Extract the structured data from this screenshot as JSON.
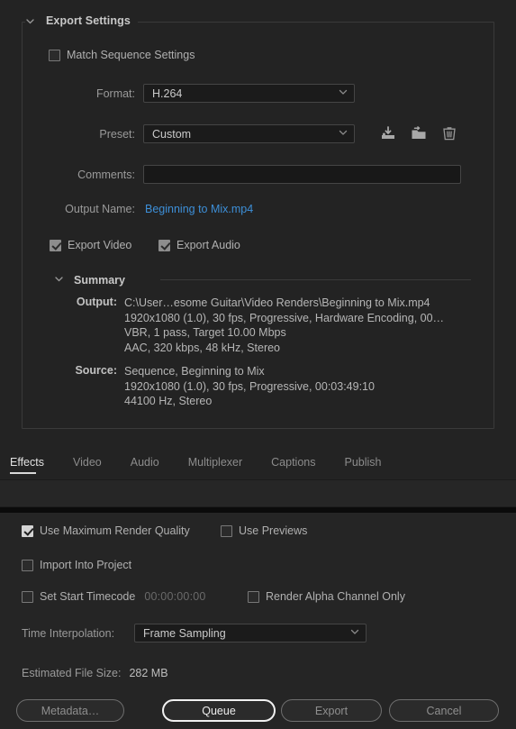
{
  "export_settings": {
    "group_title": "Export Settings",
    "twisty_icon": "chevron-down-icon",
    "match_sequence": {
      "label": "Match Sequence Settings",
      "checked": false
    },
    "format": {
      "label": "Format:",
      "value": "H.264",
      "chevron_icon": "chevron-down-icon"
    },
    "preset": {
      "label": "Preset:",
      "value": "Custom",
      "chevron_icon": "chevron-down-icon",
      "actions": [
        "save-preset-icon",
        "import-preset-icon",
        "delete-preset-icon"
      ]
    },
    "comments": {
      "label": "Comments:",
      "value": "",
      "placeholder": ""
    },
    "output_name": {
      "label": "Output Name:",
      "value": "Beginning to Mix.mp4",
      "link_color": "#3d8fd8"
    },
    "export_video": {
      "label": "Export Video",
      "checked": true
    },
    "export_audio": {
      "label": "Export Audio",
      "checked": true
    },
    "summary": {
      "title": "Summary",
      "twisty_icon": "chevron-down-icon",
      "output": {
        "key": "Output:",
        "lines": [
          "C:\\User…esome Guitar\\Video Renders\\Beginning to Mix.mp4",
          "1920x1080 (1.0), 30 fps, Progressive, Hardware Encoding, 00…",
          "VBR, 1 pass, Target 10.00 Mbps",
          "AAC, 320 kbps, 48 kHz, Stereo"
        ]
      },
      "source": {
        "key": "Source:",
        "lines": [
          "Sequence, Beginning to Mix",
          "1920x1080 (1.0), 30 fps, Progressive, 00:03:49:10",
          "44100 Hz, Stereo"
        ]
      }
    }
  },
  "tabs": [
    {
      "label": "Effects",
      "active": true
    },
    {
      "label": "Video",
      "active": false
    },
    {
      "label": "Audio",
      "active": false
    },
    {
      "label": "Multiplexer",
      "active": false
    },
    {
      "label": "Captions",
      "active": false
    },
    {
      "label": "Publish",
      "active": false
    }
  ],
  "bottom": {
    "use_max_render_quality": {
      "label": "Use Maximum Render Quality",
      "checked": true
    },
    "use_previews": {
      "label": "Use Previews",
      "checked": false
    },
    "import_into_project": {
      "label": "Import Into Project",
      "checked": false
    },
    "set_start_timecode": {
      "label": "Set Start Timecode",
      "checked": false,
      "timecode": "00:00:00:00"
    },
    "render_alpha_channel_only": {
      "label": "Render Alpha Channel Only",
      "checked": false
    },
    "time_interpolation": {
      "label": "Time Interpolation:",
      "value": "Frame Sampling",
      "chevron_icon": "chevron-down-icon"
    },
    "estimated_file_size": {
      "label": "Estimated File Size:",
      "value": "282 MB"
    },
    "buttons": {
      "metadata": "Metadata…",
      "queue": "Queue",
      "export": "Export",
      "cancel": "Cancel"
    }
  }
}
